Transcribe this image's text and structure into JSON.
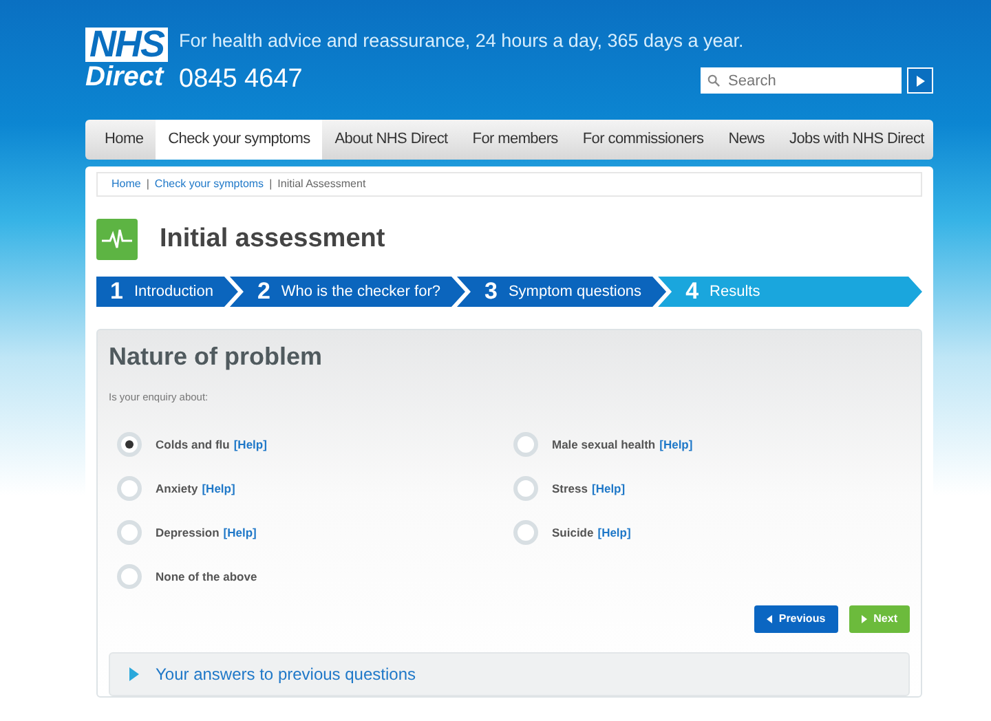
{
  "header": {
    "logo_top": "NHS",
    "logo_bottom": "Direct",
    "tagline": "For health advice and reassurance, 24 hours a day, 365 days a year.",
    "phone": "0845 4647",
    "search": {
      "placeholder": "Search"
    }
  },
  "nav": [
    {
      "label": "Home",
      "selected": false
    },
    {
      "label": "Check your symptoms",
      "selected": true
    },
    {
      "label": "About NHS Direct",
      "selected": false
    },
    {
      "label": "For members",
      "selected": false
    },
    {
      "label": "For commissioners",
      "selected": false
    },
    {
      "label": "News",
      "selected": false
    },
    {
      "label": "Jobs with NHS Direct",
      "selected": false
    }
  ],
  "breadcrumb_separator": "|",
  "breadcrumb": [
    {
      "label": "Home",
      "kind": "link"
    },
    {
      "label": "Check your symptoms",
      "kind": "link"
    },
    {
      "label": "Initial Assessment",
      "kind": "current"
    }
  ],
  "page_title": "Initial assessment",
  "steps": [
    {
      "number": "1",
      "label": "Introduction",
      "completed": true
    },
    {
      "number": "2",
      "label": "Who is the checker for?",
      "completed": true
    },
    {
      "number": "3",
      "label": "Symptom questions",
      "completed": true
    },
    {
      "number": "4",
      "label": "Results",
      "completed": false
    }
  ],
  "form": {
    "title": "Nature of problem",
    "prompt": "Is your enquiry about:",
    "options": [
      {
        "label": "Colds and flu",
        "help": "[Help]",
        "selected": true
      },
      {
        "label": "Male sexual health",
        "help": "[Help]",
        "selected": false
      },
      {
        "label": "Anxiety",
        "help": "[Help]",
        "selected": false
      },
      {
        "label": "Stress",
        "help": "[Help]",
        "selected": false
      },
      {
        "label": "Depression",
        "help": "[Help]",
        "selected": false
      },
      {
        "label": "Suicide",
        "help": "[Help]",
        "selected": false
      },
      {
        "label": "None of the above",
        "selected": false
      }
    ],
    "buttons": [
      {
        "label": "Previous",
        "kind": "previous"
      },
      {
        "label": "Next",
        "kind": "next"
      }
    ],
    "accordion": {
      "label": "Your answers to previous questions",
      "expanded": false
    }
  }
}
